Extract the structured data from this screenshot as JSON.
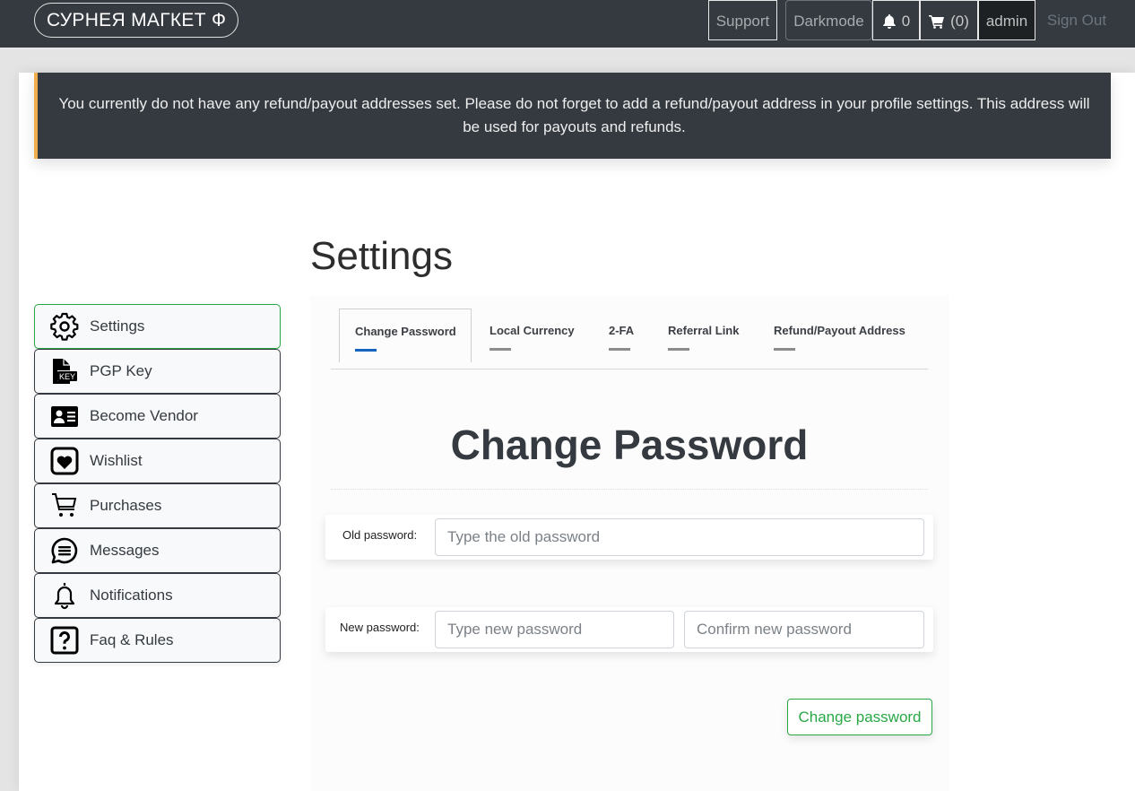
{
  "navbar": {
    "brand": "СУРНЕЯ МАГКЕТ Ф",
    "support": "Support",
    "darkmode": "Darkmode",
    "notifications_count": "0",
    "cart_count": "(0)",
    "user": "admin",
    "sign_out": "Sign Out"
  },
  "alert": {
    "message": "You currently do not have any refund/payout addresses set. Please do not forget to add a refund/payout address in your profile settings. This address will be used for payouts and refunds.",
    "accent_color": "#f0ad4e"
  },
  "page": {
    "title": "Settings"
  },
  "sidebar": {
    "items": [
      {
        "label": "Settings",
        "icon": "gear-icon",
        "active": true
      },
      {
        "label": "PGP Key",
        "icon": "key-file-icon",
        "active": false
      },
      {
        "label": "Become Vendor",
        "icon": "id-card-icon",
        "active": false
      },
      {
        "label": "Wishlist",
        "icon": "heart-icon",
        "active": false
      },
      {
        "label": "Purchases",
        "icon": "cart-icon",
        "active": false
      },
      {
        "label": "Messages",
        "icon": "chat-icon",
        "active": false
      },
      {
        "label": "Notifications",
        "icon": "bell-icon",
        "active": false
      },
      {
        "label": "Faq & Rules",
        "icon": "question-icon",
        "active": false
      }
    ]
  },
  "tabs": [
    {
      "label": "Change Password",
      "active": true
    },
    {
      "label": "Local Currency",
      "active": false
    },
    {
      "label": "2-FA",
      "active": false
    },
    {
      "label": "Referral Link",
      "active": false
    },
    {
      "label": "Refund/Payout Address",
      "active": false
    }
  ],
  "form": {
    "title": "Change Password",
    "old_label": "Old password:",
    "old_placeholder": "Type the old password",
    "new_label": "New password:",
    "new_placeholder": "Type new password",
    "confirm_placeholder": "Confirm new password",
    "submit": "Change password"
  },
  "colors": {
    "navbar_bg": "#343a40",
    "active_accent": "#28a745",
    "tab_active_bar": "#1565c0"
  }
}
